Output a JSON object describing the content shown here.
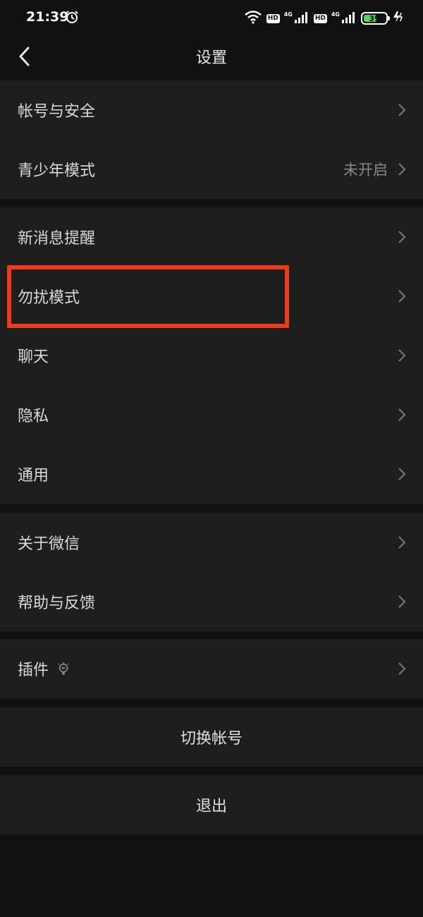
{
  "status_bar": {
    "time": "21:39",
    "hd1": "HD",
    "hd2": "HD",
    "net1": "4G",
    "net2": "4G",
    "battery": "39"
  },
  "header": {
    "title": "设置"
  },
  "groups": [
    {
      "items": [
        {
          "label": "帐号与安全",
          "value": ""
        },
        {
          "label": "青少年模式",
          "value": "未开启"
        }
      ]
    },
    {
      "items": [
        {
          "label": "新消息提醒",
          "value": ""
        },
        {
          "label": "勿扰模式",
          "value": ""
        },
        {
          "label": "聊天",
          "value": ""
        },
        {
          "label": "隐私",
          "value": ""
        },
        {
          "label": "通用",
          "value": ""
        }
      ]
    },
    {
      "items": [
        {
          "label": "关于微信",
          "value": ""
        },
        {
          "label": "帮助与反馈",
          "value": ""
        }
      ]
    },
    {
      "items": [
        {
          "label": "插件",
          "value": "",
          "icon": "plugin-bulb-icon"
        }
      ]
    }
  ],
  "actions": {
    "switch_account": "切换帐号",
    "logout": "退出"
  },
  "colors": {
    "background": "#111111",
    "cell": "#1e1e1e",
    "highlight": "#f03a1c",
    "battery": "#5fd35f"
  }
}
